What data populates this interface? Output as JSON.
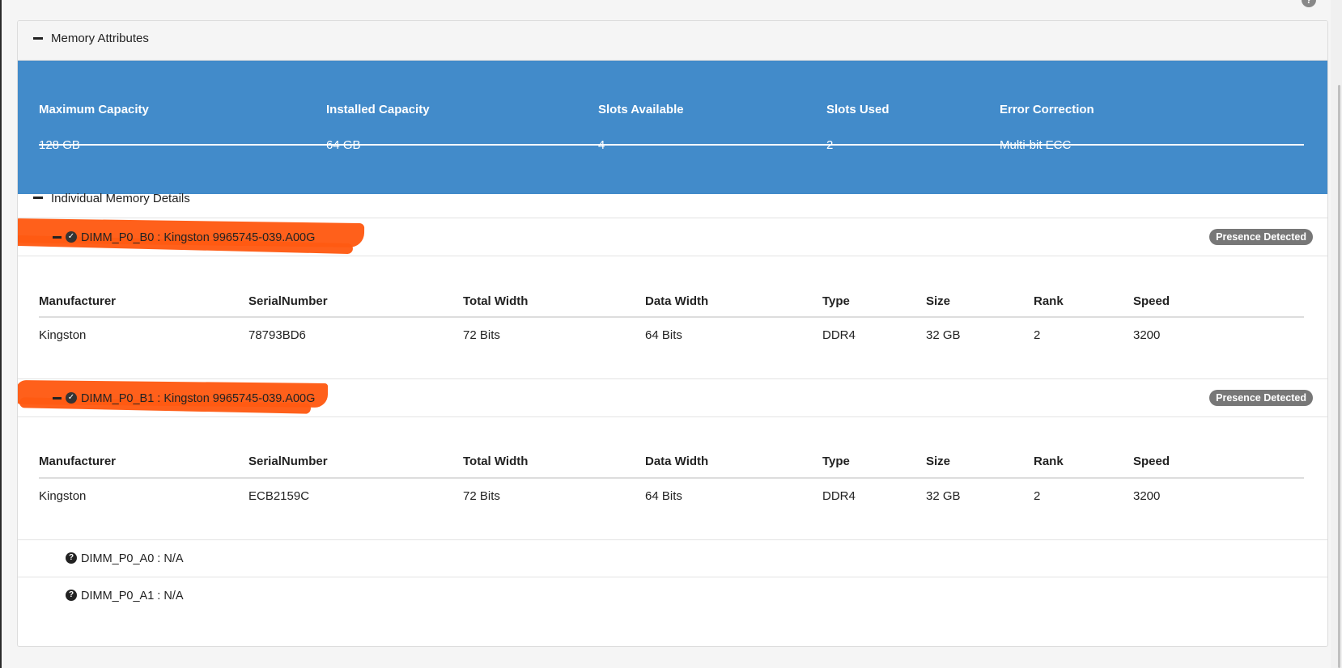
{
  "memory_attributes": {
    "title": "Memory Attributes",
    "headers": [
      "Maximum Capacity",
      "Installed Capacity",
      "Slots Available",
      "Slots Used",
      "Error Correction"
    ],
    "values": [
      "128 GB",
      "64 GB",
      "4",
      "2",
      "Multi-bit ECC"
    ]
  },
  "individual": {
    "title": "Individual Memory Details",
    "dimms": [
      {
        "name": "DIMM_P0_B0 : Kingston 9965745-039.A00G",
        "status": "Presence Detected",
        "headers": [
          "Manufacturer",
          "SerialNumber",
          "Total Width",
          "Data Width",
          "Type",
          "Size",
          "Rank",
          "Speed"
        ],
        "values": [
          "Kingston",
          "78793BD6",
          "72 Bits",
          "64 Bits",
          "DDR4",
          "32 GB",
          "2",
          "3200"
        ]
      },
      {
        "name": "DIMM_P0_B1 : Kingston 9965745-039.A00G",
        "status": "Presence Detected",
        "headers": [
          "Manufacturer",
          "SerialNumber",
          "Total Width",
          "Data Width",
          "Type",
          "Size",
          "Rank",
          "Speed"
        ],
        "values": [
          "Kingston",
          "ECB2159C",
          "72 Bits",
          "64 Bits",
          "DDR4",
          "32 GB",
          "2",
          "3200"
        ]
      }
    ],
    "empty_slots": [
      {
        "name": "DIMM_P0_A0 : N/A"
      },
      {
        "name": "DIMM_P0_A1 : N/A"
      }
    ]
  },
  "icons": {
    "collapse": "minus-icon",
    "present": "check-circle-icon",
    "unknown": "question-circle-icon"
  },
  "colors": {
    "attr_panel": "#428bca",
    "badge": "#777777",
    "redaction": "#ff5a12"
  }
}
